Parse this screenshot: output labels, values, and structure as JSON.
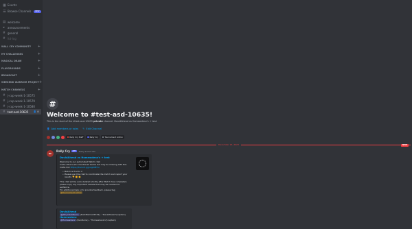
{
  "sidebar": {
    "top_items": [
      {
        "label": "Events",
        "icon": "calendar-icon"
      },
      {
        "label": "Browse Channels",
        "icon": "browse-icon",
        "badge": "NEW"
      }
    ],
    "channels_top": [
      {
        "label": "welcome",
        "icon": "rules-icon"
      },
      {
        "label": "announcements",
        "icon": "announcement-icon"
      },
      {
        "label": "general",
        "icon": "hash-icon"
      },
      {
        "label": "ltd-log",
        "icon": "hash-icon",
        "muted": true
      }
    ],
    "categories": [
      "WALL CRY COMMUNITY",
      "MY CHALLENGES",
      "MAGICAL DRAW",
      "PLAYGROUNDS",
      "BROADCAST",
      "WEEKEND WARRIOR PROJECT",
      "MATCH CHANNELS"
    ],
    "match_channels": [
      {
        "label": "j-cup-week-1-10575"
      },
      {
        "label": "j-cup-week-1-10579"
      },
      {
        "label": "j-cup-week-1-10580"
      },
      {
        "label": "test-asd-10635",
        "active": true
      }
    ]
  },
  "welcome": {
    "icon": "#",
    "title": "Welcome to #test-asd-10635!",
    "subtitle_pre": "This is the start of the #test-asd-10635 ",
    "subtitle_bold": "private",
    "subtitle_post": " channel. DavidAhead vs Homewdenz's + test",
    "add_members": "Add members or roles",
    "edit_channel": "Edit Channel",
    "roles": [
      {
        "label": "Rally Cry Staff",
        "color": "#e74c3c"
      },
      {
        "label": "Rally Cry",
        "color": "#5865f2"
      },
      {
        "label": "Tournament Admin",
        "color": "#949ba4"
      }
    ],
    "avatar_colors": [
      "#a2332e",
      "#7289da",
      "#43b581",
      "#f23f43"
    ]
  },
  "divider": {
    "date": "December 13, 2023",
    "new_label": "NEW"
  },
  "message": {
    "avatar_text": "RC",
    "author": "Rally Cry",
    "app_tag": "APP",
    "timestamp": "Today at 8:27 PM",
    "embed": {
      "title": "DavidAhead vs Homewdenz's + test",
      "lines": [
        "Welcome to our automated Match chat",
        "Invite others who mentioned below but may be missing with this",
        "invite link "
      ],
      "invite_link": "https://discord.gg/uqp48hYu",
      "bullets": [
        "Match is first to 2",
        "Please use this chat to coordinate the match and report your",
        "results 🏆 ✊ 👏"
      ],
      "footer_lines": [
        "This chat will be auto-deleted shortly after Match has completed,",
        "please copy any important details that may be needed for",
        "evidence.",
        "For additional help or to provide feedback, please tag"
      ],
      "mention": "@Tournament Admin"
    },
    "embed2": {
      "title": "DavidAhead",
      "line1_mention": "@[RC] DarkMemo",
      "line1_rest": " (DarkMemo#4729) - \"DavidAhead\"(captain)",
      "title2": "Homewdenz",
      "line2_mention": "@Homewdenz",
      "line2_rest": " (DenBurns) - \"Homewdenz's\"(captain)"
    }
  }
}
